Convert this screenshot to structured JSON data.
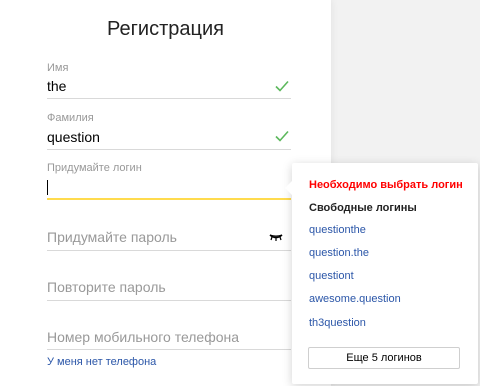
{
  "form": {
    "title": "Регистрация",
    "first_name": {
      "label": "Имя",
      "value": "the"
    },
    "last_name": {
      "label": "Фамилия",
      "value": "question"
    },
    "login": {
      "label": "Придумайте логин",
      "value": ""
    },
    "password": {
      "placeholder": "Придумайте пароль"
    },
    "password_repeat": {
      "placeholder": "Повторите пароль"
    },
    "phone": {
      "placeholder": "Номер мобильного телефона"
    },
    "no_phone_link": "У меня нет телефона"
  },
  "popup": {
    "error": "Необходимо выбрать логин",
    "heading": "Свободные логины",
    "suggestions": [
      "questionthe",
      "question.the",
      "questiont",
      "awesome.question",
      "th3question"
    ],
    "more_button": "Еще 5 логинов"
  },
  "colors": {
    "accent": "#ffdb4d",
    "check": "#5cb85c",
    "error": "#ff0000",
    "link": "#2b56a8"
  }
}
